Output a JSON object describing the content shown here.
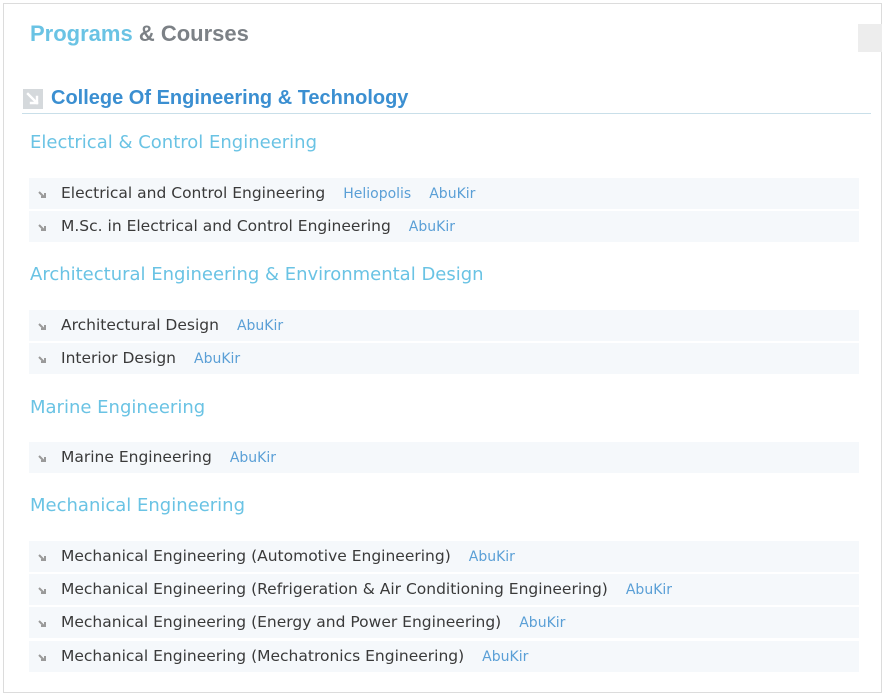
{
  "header": {
    "title_part1": "Programs",
    "title_part2": "& Courses"
  },
  "college": {
    "title": "College Of Engineering & Technology"
  },
  "sections": [
    {
      "title": "Electrical & Control Engineering",
      "programs": [
        {
          "name": "Electrical and Control Engineering",
          "campuses": [
            "Heliopolis",
            "AbuKir"
          ]
        },
        {
          "name": "M.Sc. in Electrical and Control Engineering",
          "campuses": [
            "AbuKir"
          ]
        }
      ]
    },
    {
      "title": "Architectural Engineering & Environmental Design",
      "programs": [
        {
          "name": "Architectural Design",
          "campuses": [
            "AbuKir"
          ]
        },
        {
          "name": "Interior Design",
          "campuses": [
            "AbuKir"
          ]
        }
      ]
    },
    {
      "title": "Marine Engineering",
      "programs": [
        {
          "name": "Marine Engineering",
          "campuses": [
            "AbuKir"
          ]
        }
      ]
    },
    {
      "title": "Mechanical Engineering",
      "programs": [
        {
          "name": "Mechanical Engineering (Automotive Engineering)",
          "campuses": [
            "AbuKir"
          ]
        },
        {
          "name": "Mechanical Engineering (Refrigeration & Air Conditioning Engineering)",
          "campuses": [
            "AbuKir"
          ]
        },
        {
          "name": "Mechanical Engineering (Energy and Power Engineering)",
          "campuses": [
            "AbuKir"
          ]
        },
        {
          "name": "Mechanical Engineering (Mechatronics Engineering)",
          "campuses": [
            "AbuKir"
          ]
        }
      ]
    }
  ],
  "icons": {
    "college": "expand-arrow-icon",
    "bullet": "bullet-arrow-icon"
  },
  "colors": {
    "accent_light": "#6ac3e4",
    "accent_dark": "#3b8fd1",
    "link": "#5a9fd6",
    "row_bg": "#f5f8fb"
  }
}
